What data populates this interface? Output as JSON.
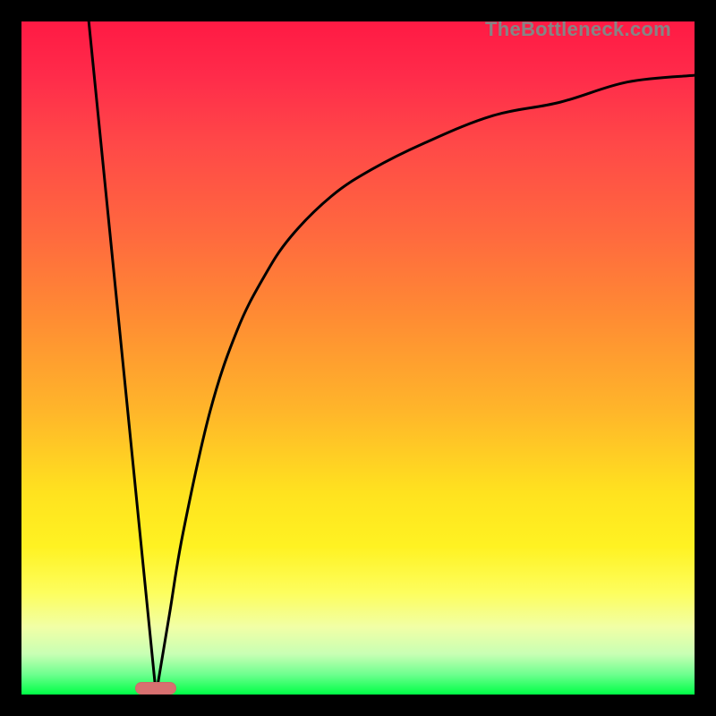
{
  "watermark": "TheBottleneck.com",
  "colors": {
    "frame": "#000000",
    "curve": "#000000",
    "marker": "#d87070",
    "gradient_stops": [
      "#ff1a44",
      "#ff4848",
      "#ff8c33",
      "#ffe21f",
      "#fdfe5f",
      "#6eff8f",
      "#00ff46"
    ]
  },
  "chart_data": {
    "type": "line",
    "title": "",
    "xlabel": "",
    "ylabel": "",
    "xlim": [
      0,
      100
    ],
    "ylim": [
      0,
      100
    ],
    "grid": false,
    "series": [
      {
        "name": "curve",
        "x": [
          10,
          12,
          14,
          16,
          18,
          19,
          20,
          22,
          24,
          28,
          32,
          36,
          40,
          46,
          52,
          60,
          70,
          80,
          90,
          100
        ],
        "y": [
          100,
          80,
          60,
          40,
          20,
          10,
          0,
          12,
          24,
          42,
          54,
          62,
          68,
          74,
          78,
          82,
          86,
          88,
          91,
          92
        ]
      }
    ],
    "annotations": [
      {
        "name": "trough-marker",
        "type": "pill",
        "x": 20,
        "y": 0,
        "color": "#d87070"
      }
    ]
  }
}
